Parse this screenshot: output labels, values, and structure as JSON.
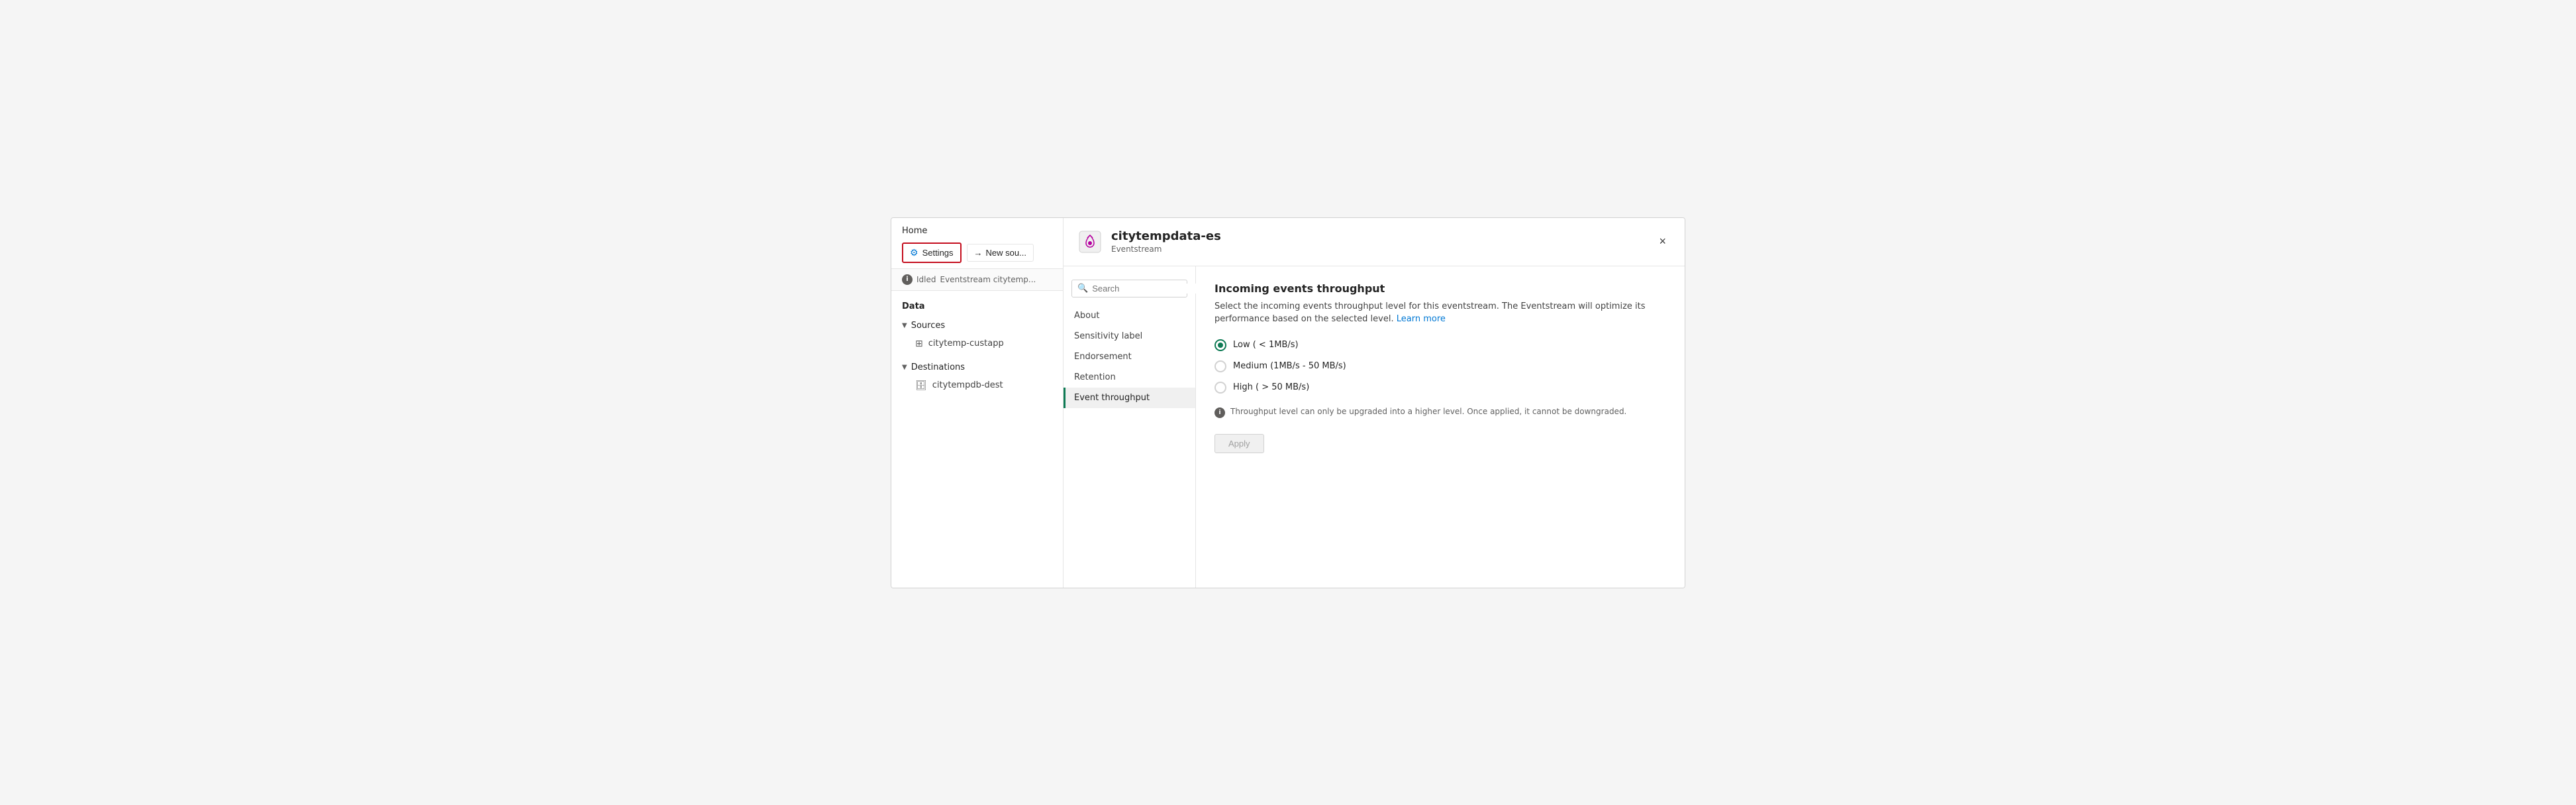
{
  "sidebar": {
    "home_label": "Home",
    "settings_label": "Settings",
    "new_source_label": "New sou...",
    "status": {
      "icon": "i",
      "state": "Idled",
      "description": "Eventstream citytemp..."
    },
    "data_section": "Data",
    "sources": {
      "label": "Sources",
      "items": [
        {
          "name": "citytemp-custapp"
        }
      ]
    },
    "destinations": {
      "label": "Destinations",
      "items": [
        {
          "name": "citytempdb-dest"
        }
      ]
    }
  },
  "dialog": {
    "title": "citytempdata-es",
    "subtitle": "Eventstream",
    "close_label": "×",
    "search_placeholder": "Search",
    "nav_items": [
      {
        "label": "About",
        "id": "about"
      },
      {
        "label": "Sensitivity label",
        "id": "sensitivity"
      },
      {
        "label": "Endorsement",
        "id": "endorsement"
      },
      {
        "label": "Retention",
        "id": "retention"
      },
      {
        "label": "Event throughput",
        "id": "event-throughput",
        "active": true
      }
    ],
    "content": {
      "title": "Incoming events throughput",
      "description": "Select the incoming events throughput level for this eventstream. The Eventstream will optimize its performance based on the selected level.",
      "learn_more": "Learn more",
      "options": [
        {
          "id": "low",
          "label": "Low ( < 1MB/s)",
          "selected": true
        },
        {
          "id": "medium",
          "label": "Medium (1MB/s - 50 MB/s)",
          "selected": false
        },
        {
          "id": "high",
          "label": "High ( > 50 MB/s)",
          "selected": false
        }
      ],
      "warning": "Throughput level can only be upgraded into a higher level. Once applied, it cannot be downgraded.",
      "apply_label": "Apply"
    }
  }
}
